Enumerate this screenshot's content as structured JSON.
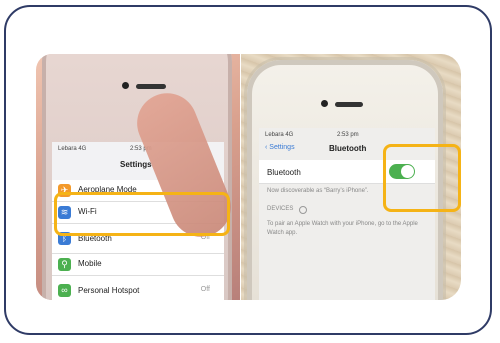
{
  "left_screen": {
    "status_carrier": "Lebara 4G",
    "status_time": "2:53 pm",
    "title": "Settings",
    "rows": [
      {
        "label": "Aeroplane Mode",
        "value": "",
        "color": "#f39a2b",
        "icon": "airplane-icon"
      },
      {
        "label": "Wi-Fi",
        "value": "",
        "color": "#3a7bd5",
        "icon": "wifi-icon"
      },
      {
        "label": "Bluetooth",
        "value": "Off",
        "color": "#3a7bd5",
        "icon": "bluetooth-icon"
      },
      {
        "label": "Mobile",
        "value": "",
        "color": "#4cb050",
        "icon": "antenna-icon"
      },
      {
        "label": "Personal Hotspot",
        "value": "Off",
        "color": "#4cb050",
        "icon": "link-icon"
      }
    ]
  },
  "right_screen": {
    "status_carrier": "Lebara 4G",
    "status_time": "2:53 pm",
    "back_label": "Settings",
    "title": "Bluetooth",
    "bluetooth_label": "Bluetooth",
    "toggle_on": true,
    "discoverable_text": "Now discoverable as “Barry’s iPhone”.",
    "devices_header": "DEVICES",
    "pair_text": "To pair an Apple Watch with your iPhone, go to the Apple Watch app."
  },
  "colors": {
    "highlight": "#f5b316",
    "frame": "#2f3b66",
    "toggle_green": "#4cb050"
  }
}
